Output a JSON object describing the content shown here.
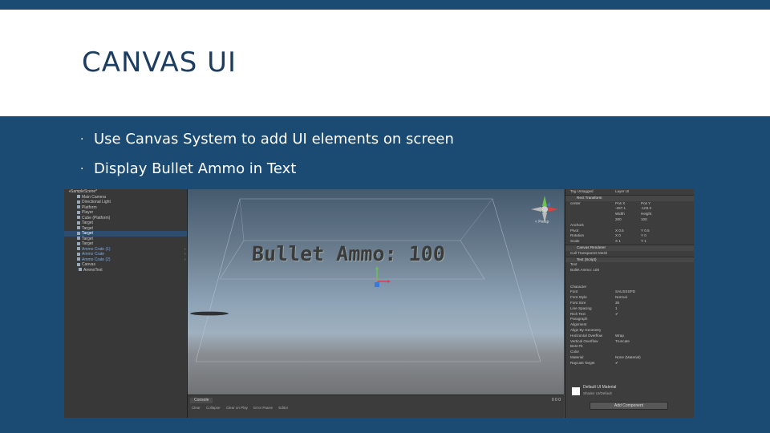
{
  "slide": {
    "title": "CANVAS UI",
    "bullets": [
      "Use Canvas System to add UI elements on screen",
      "Display Bullet Ammo in Text"
    ]
  },
  "colors": {
    "band": "#1b4a73",
    "title": "#1c3d5f"
  },
  "unity": {
    "hierarchy": {
      "root": "SampleScene*",
      "items": [
        {
          "label": "Main Camera",
          "style": "normal"
        },
        {
          "label": "Directional Light",
          "style": "normal"
        },
        {
          "label": "Platform",
          "style": "normal"
        },
        {
          "label": "Player",
          "style": "normal"
        },
        {
          "label": "Cube (Platform)",
          "style": "normal"
        },
        {
          "label": "Target",
          "style": "normal"
        },
        {
          "label": "Target",
          "style": "normal"
        },
        {
          "label": "Target",
          "style": "selected"
        },
        {
          "label": "Target",
          "style": "normal"
        },
        {
          "label": "Target",
          "style": "normal"
        },
        {
          "label": "Ammo Crate (1)",
          "style": "blue"
        },
        {
          "label": "Ammo Crate",
          "style": "blue"
        },
        {
          "label": "Ammo Crate (2)",
          "style": "blue"
        },
        {
          "label": "Canvas",
          "style": "normal"
        },
        {
          "label": "AmmoText",
          "style": "child"
        }
      ]
    },
    "scene": {
      "ammo_text": "Bullet Ammo: 100",
      "persp_label": "< Persp"
    },
    "console": {
      "tab": "Console",
      "tools": [
        "Clear",
        "Collapse",
        "Clear on Play",
        "Error Pause",
        "Editor"
      ],
      "counts": "0  0  0"
    },
    "inspector": {
      "rows": [
        {
          "type": "row",
          "label": "Tag  Untagged",
          "val": "Layer  UI"
        },
        {
          "type": "header",
          "label": "Rect Transform"
        },
        {
          "type": "row",
          "label": "center",
          "val": "Pos X",
          "val2": "Pos Y"
        },
        {
          "type": "row",
          "label": "",
          "val": "-267.1",
          "val2": "-103.3"
        },
        {
          "type": "row",
          "label": "",
          "val": "Width",
          "val2": "Height"
        },
        {
          "type": "row",
          "label": "",
          "val": "200",
          "val2": "100"
        },
        {
          "type": "row",
          "label": "Anchors",
          "val": ""
        },
        {
          "type": "row",
          "label": "Pivot",
          "val": "X 0.5",
          "val2": "Y 0.5"
        },
        {
          "type": "row",
          "label": "Rotation",
          "val": "X 0",
          "val2": "Y 0"
        },
        {
          "type": "row",
          "label": "Scale",
          "val": "X 1",
          "val2": "Y 1"
        },
        {
          "type": "header",
          "label": "Canvas Renderer"
        },
        {
          "type": "row",
          "label": "Cull Transparent Mesh",
          "val": ""
        },
        {
          "type": "header",
          "label": "Text (Script)"
        },
        {
          "type": "row",
          "label": "Text",
          "val": ""
        },
        {
          "type": "row",
          "label": "Bullet Ammo: 100",
          "val": ""
        },
        {
          "type": "row",
          "label": "",
          "val": ""
        },
        {
          "type": "row",
          "label": "",
          "val": ""
        },
        {
          "type": "row",
          "label": "Character",
          "val": ""
        },
        {
          "type": "row",
          "label": "Font",
          "val": "SAUSSSPD"
        },
        {
          "type": "row",
          "label": "Font Style",
          "val": "Normal"
        },
        {
          "type": "row",
          "label": "Font Size",
          "val": "35"
        },
        {
          "type": "row",
          "label": "Line Spacing",
          "val": "1"
        },
        {
          "type": "row",
          "label": "Rich Text",
          "val": "✔"
        },
        {
          "type": "row",
          "label": "Paragraph",
          "val": ""
        },
        {
          "type": "row",
          "label": "Alignment",
          "val": ""
        },
        {
          "type": "row",
          "label": "Align By Geometry",
          "val": ""
        },
        {
          "type": "row",
          "label": "Horizontal Overflow",
          "val": "Wrap"
        },
        {
          "type": "row",
          "label": "Vertical Overflow",
          "val": "Truncate"
        },
        {
          "type": "row",
          "label": "Best Fit",
          "val": ""
        },
        {
          "type": "row",
          "label": "Color",
          "val": ""
        },
        {
          "type": "row",
          "label": "Material",
          "val": "None (Material)"
        },
        {
          "type": "row",
          "label": "Raycast Target",
          "val": "✔"
        }
      ],
      "material_label": "Default UI Material",
      "shader_label": "Shader  UI/Default",
      "add_component": "Add Component"
    }
  }
}
